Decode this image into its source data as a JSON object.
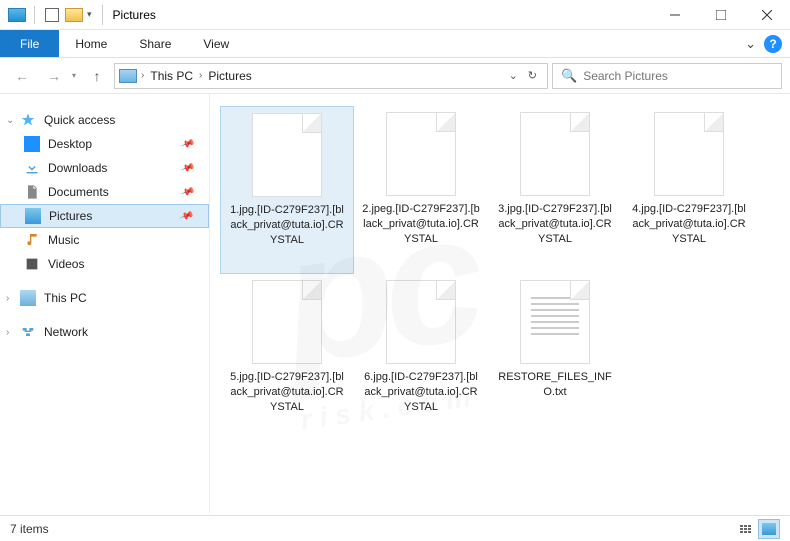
{
  "window": {
    "title": "Pictures"
  },
  "ribbon": {
    "file": "File",
    "tabs": [
      "Home",
      "Share",
      "View"
    ]
  },
  "breadcrumb": {
    "items": [
      "This PC",
      "Pictures"
    ]
  },
  "search": {
    "placeholder": "Search Pictures"
  },
  "sidebar": {
    "quick_access": "Quick access",
    "desktop": "Desktop",
    "downloads": "Downloads",
    "documents": "Documents",
    "pictures": "Pictures",
    "music": "Music",
    "videos": "Videos",
    "this_pc": "This PC",
    "network": "Network"
  },
  "files": [
    {
      "name": "1.jpg.[ID-C279F237].[black_privat@tuta.io].CRYSTAL",
      "type": "blank",
      "selected": true
    },
    {
      "name": "2.jpeg.[ID-C279F237].[black_privat@tuta.io].CRYSTAL",
      "type": "blank",
      "selected": false
    },
    {
      "name": "3.jpg.[ID-C279F237].[black_privat@tuta.io].CRYSTAL",
      "type": "blank",
      "selected": false
    },
    {
      "name": "4.jpg.[ID-C279F237].[black_privat@tuta.io].CRYSTAL",
      "type": "blank",
      "selected": false
    },
    {
      "name": "5.jpg.[ID-C279F237].[black_privat@tuta.io].CRYSTAL",
      "type": "blank",
      "selected": false
    },
    {
      "name": "6.jpg.[ID-C279F237].[black_privat@tuta.io].CRYSTAL",
      "type": "blank",
      "selected": false
    },
    {
      "name": "RESTORE_FILES_INFO.txt",
      "type": "txt",
      "selected": false
    }
  ],
  "status": {
    "count": "7 items"
  }
}
